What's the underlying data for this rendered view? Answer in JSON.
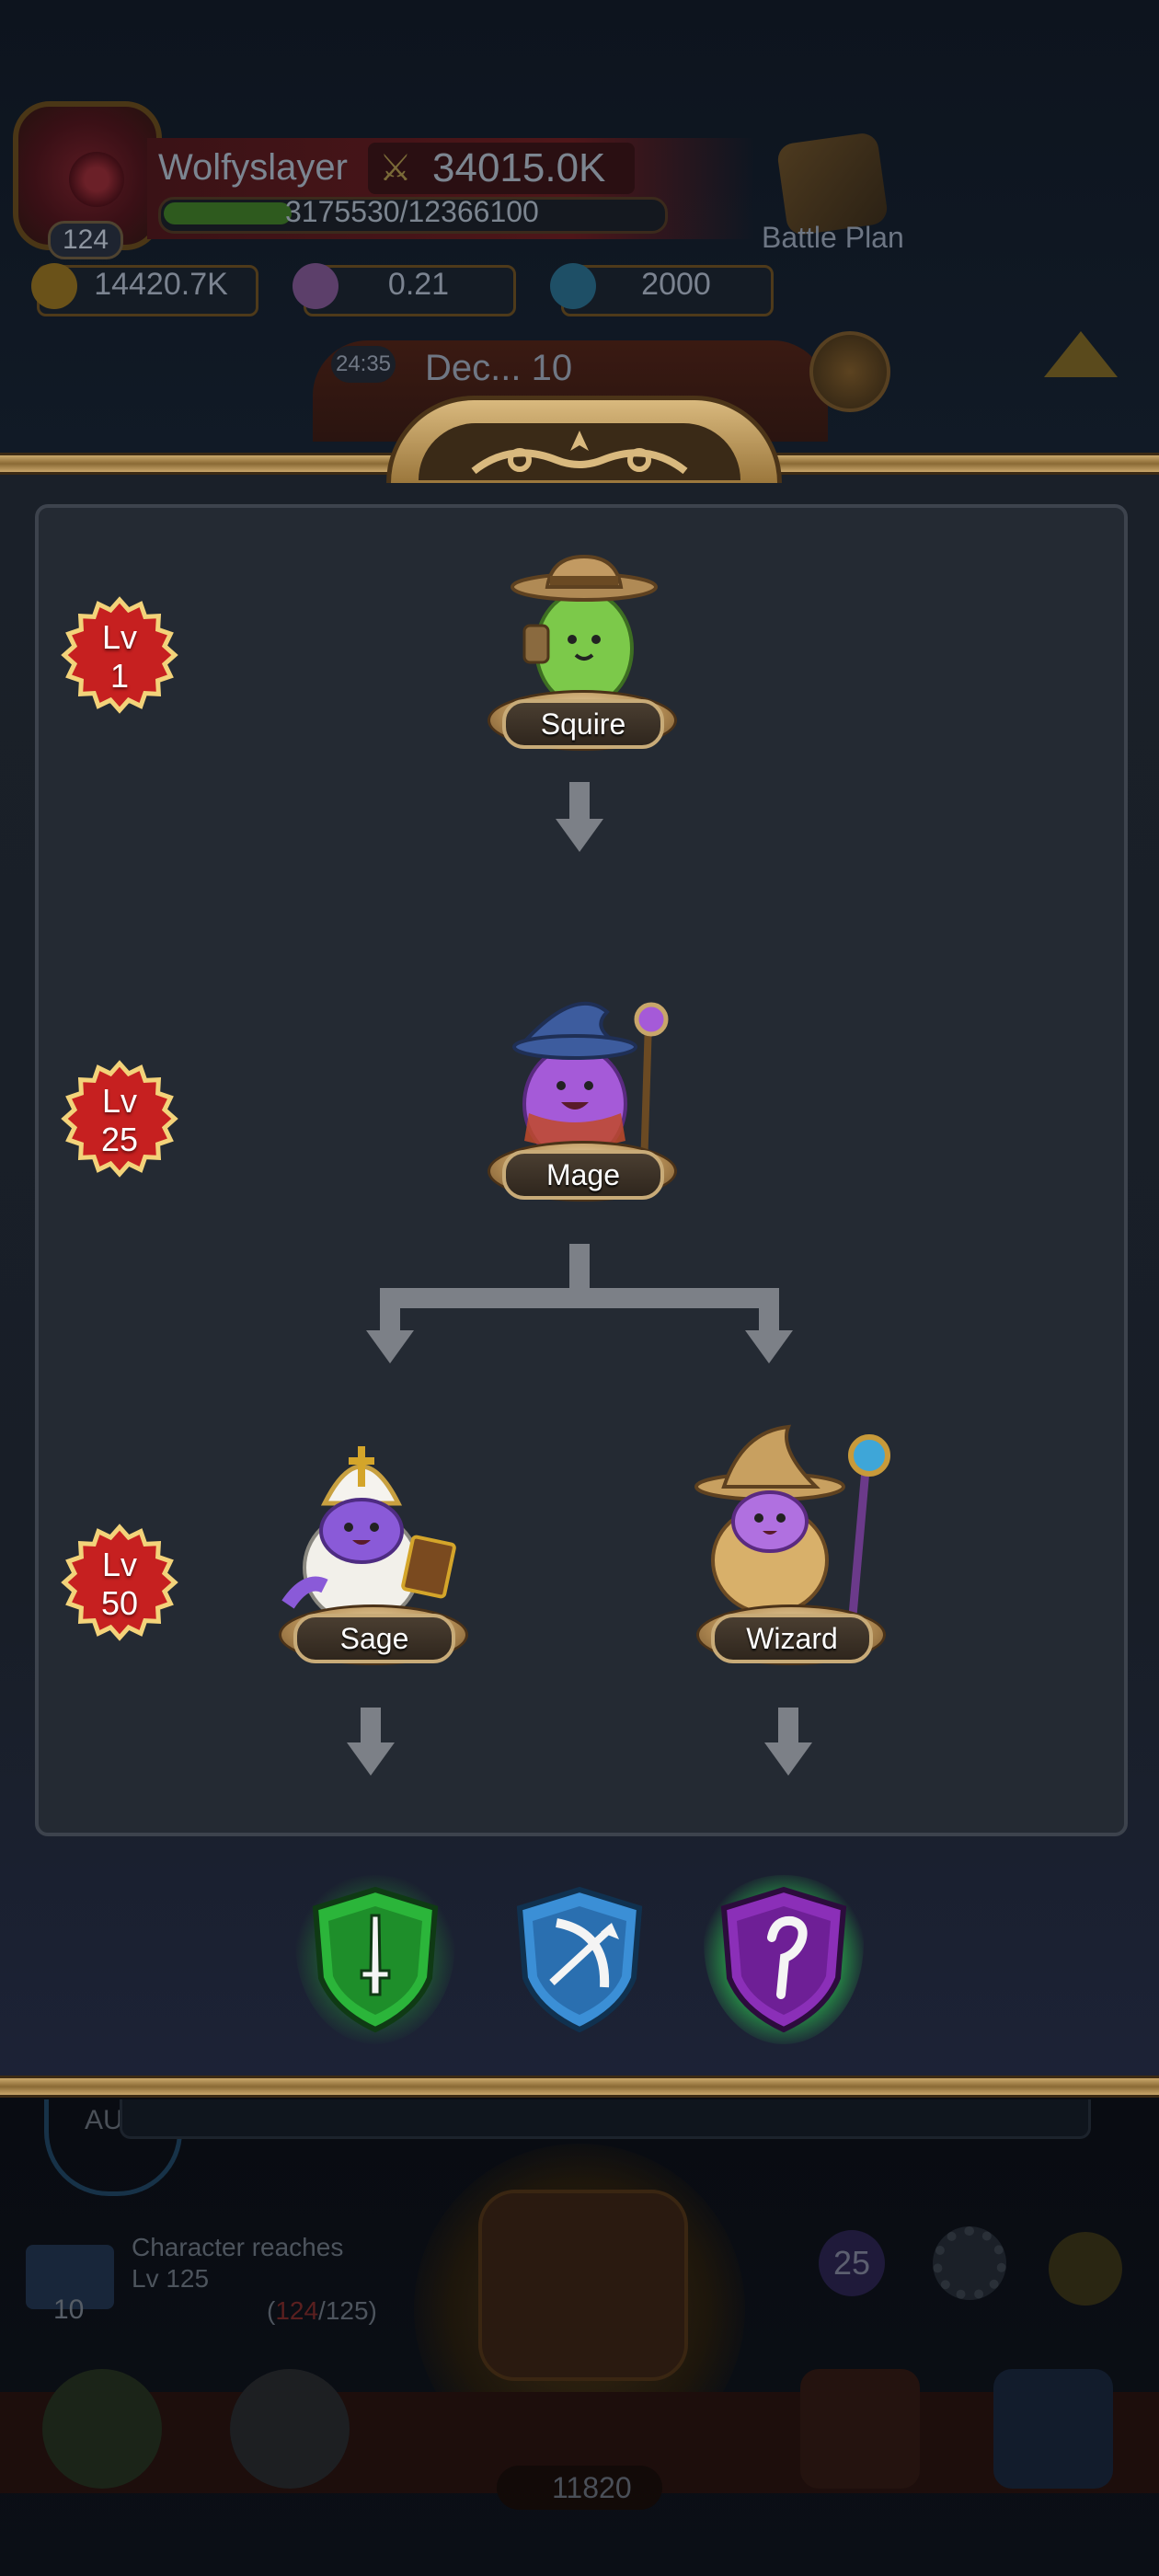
{
  "header": {
    "player_name": "Wolfyslayer",
    "player_level": "124",
    "combat_power": "34015.0K",
    "xp_text": "3175530/12366100",
    "xp_fraction": 0.2568,
    "battle_plan_label": "Battle Plan"
  },
  "currency": [
    {
      "name": "gold-coin",
      "value": "14420.7K"
    },
    {
      "name": "gem-star",
      "value": "0.21"
    },
    {
      "name": "blue-gem",
      "value": "2000"
    }
  ],
  "event_banner": {
    "timer": "24:35",
    "text": "Dec... 10"
  },
  "modal": {
    "levels": [
      {
        "label": "Lv",
        "value": "1"
      },
      {
        "label": "Lv",
        "value": "25"
      },
      {
        "label": "Lv",
        "value": "50"
      }
    ],
    "classes": [
      {
        "name": "Squire"
      },
      {
        "name": "Mage"
      },
      {
        "name": "Sage"
      },
      {
        "name": "Wizard"
      }
    ],
    "class_icons": [
      {
        "icon": "sword-shield-icon",
        "color": "#2bb53a"
      },
      {
        "icon": "bow-shield-icon",
        "color": "#3b8fd6"
      },
      {
        "icon": "staff-shield-icon",
        "color": "#8b2fb8"
      }
    ]
  },
  "bottom_bg": {
    "auto_label": "AU ON",
    "quest_text": "Character reaches Lv 125",
    "quest_progress_current": "124",
    "quest_progress_total": "/125)",
    "quest_progress_open": "(",
    "quest_badge": "10",
    "round_badge": "25",
    "chest_count": "11820"
  },
  "colors": {
    "gold_frame": "#c8a66a",
    "panel": "#242a33",
    "badge_red": "#c62020"
  }
}
